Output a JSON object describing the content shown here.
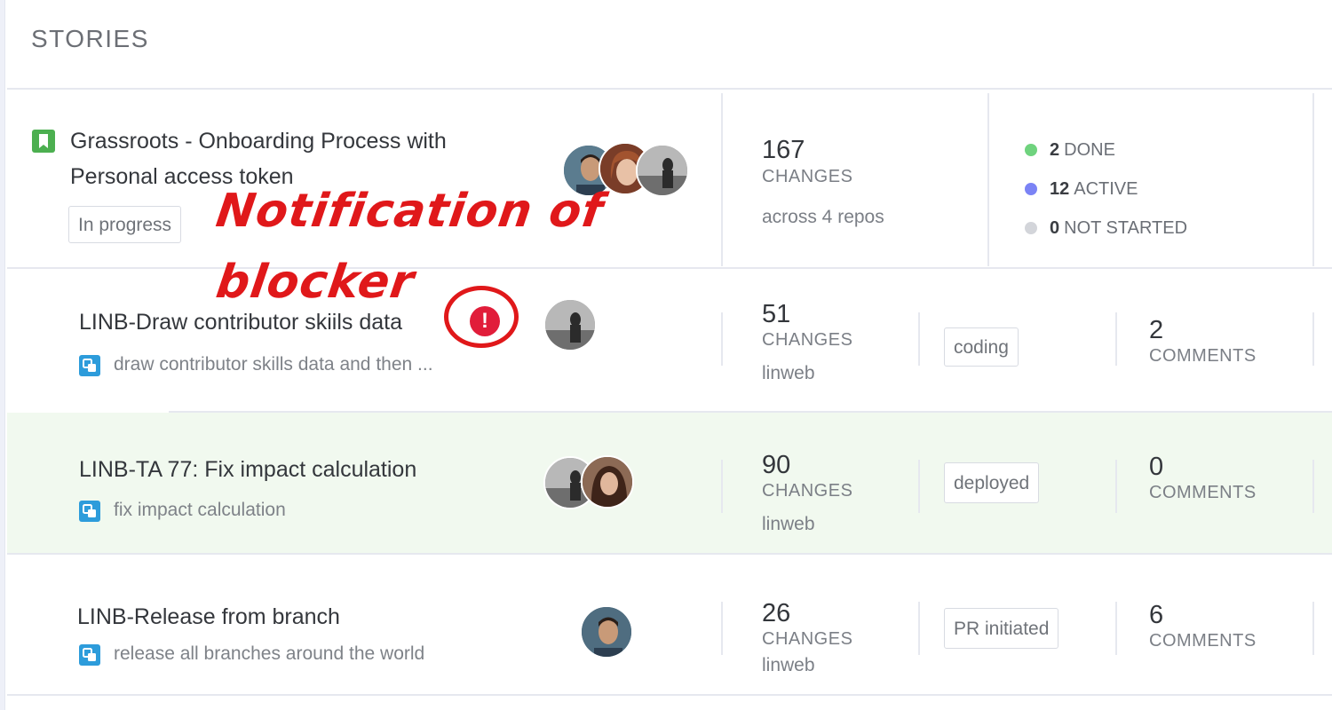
{
  "section": {
    "title": "STORIES"
  },
  "annotation": {
    "line1": "Notification of",
    "line2": "blocker"
  },
  "epic": {
    "icon": "bookmark-icon",
    "icon_color": "#4caf50",
    "title_line1": "Grassroots - Onboarding Process with",
    "title_line2": "Personal access token",
    "status": "In progress",
    "changes_count": "167",
    "changes_label": "CHANGES",
    "repos_text": "across 4 repos",
    "progress": [
      {
        "count": "2",
        "label": "DONE",
        "color": "#6fd37e"
      },
      {
        "count": "12",
        "label": "ACTIVE",
        "color": "#7b83f5"
      },
      {
        "count": "0",
        "label": "NOT STARTED",
        "color": "#d3d5da"
      }
    ]
  },
  "tasks": [
    {
      "title": "LINB-Draw contributor skiils data",
      "subtitle": "draw contributor skills data and then ...",
      "has_blocker": true,
      "blocker_icon": "exclamation-icon",
      "changes_count": "51",
      "changes_label": "CHANGES",
      "repo": "linweb",
      "status": "coding",
      "comments_count": "2",
      "comments_label": "COMMENTS"
    },
    {
      "title": "LINB-TA 77: Fix impact calculation",
      "subtitle": "fix impact calculation",
      "has_blocker": false,
      "changes_count": "90",
      "changes_label": "CHANGES",
      "repo": "linweb",
      "status": "deployed",
      "comments_count": "0",
      "comments_label": "COMMENTS"
    },
    {
      "title": "LINB-Release from branch",
      "subtitle": "release all branches around the world",
      "has_blocker": false,
      "changes_count": "26",
      "changes_label": "CHANGES",
      "repo": "linweb",
      "status": "PR initiated",
      "comments_count": "6",
      "comments_label": "COMMENTS"
    }
  ],
  "colors": {
    "task_icon": "#2d9cdb",
    "highlight_row": "#f1f9ef",
    "annotation": "#e0181a",
    "blocker": "#e11d3a"
  }
}
